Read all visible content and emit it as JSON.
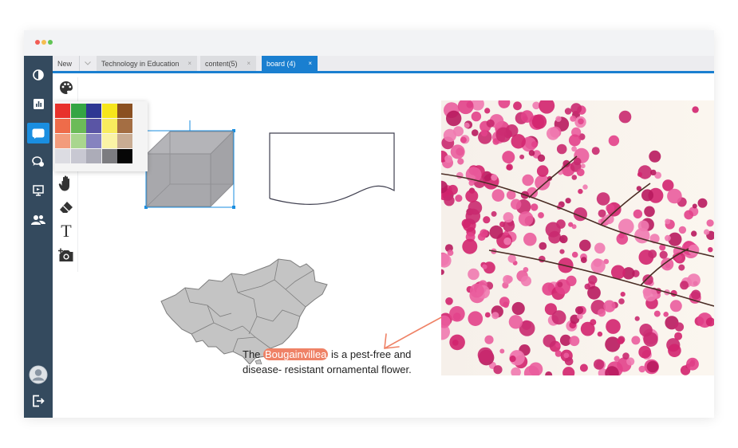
{
  "window_controls": {
    "colors": [
      "#f25c54",
      "#f5bd4f",
      "#61c454"
    ]
  },
  "sidebar": {
    "items": [
      {
        "name": "contrast-icon",
        "active": false
      },
      {
        "name": "bar-chart-icon",
        "active": false
      },
      {
        "name": "whiteboard-icon",
        "active": true
      },
      {
        "name": "chat-icon",
        "active": false
      },
      {
        "name": "presentation-icon",
        "active": false
      },
      {
        "name": "users-icon",
        "active": false
      }
    ],
    "bottom": [
      {
        "name": "avatar-icon"
      },
      {
        "name": "logout-icon"
      }
    ]
  },
  "tabs": [
    {
      "label": "New",
      "active": false
    },
    {
      "label": "Technology in Education",
      "close": "×",
      "active": false
    },
    {
      "label": "content(5)",
      "close": "×",
      "active": false
    },
    {
      "label": "board (4)",
      "close": "×",
      "active": true
    }
  ],
  "toolbar": {
    "tools": [
      "palette-icon",
      "hand-icon",
      "eraser-icon",
      "text-icon",
      "add-image-icon"
    ],
    "text_tool_glyph": "T"
  },
  "palette": {
    "columns": [
      [
        "#e8312b",
        "#ee6c4a",
        "#f39c7c",
        "#dcdce2"
      ],
      [
        "#34a543",
        "#6cbb58",
        "#a9d68e",
        "#c8c8d2"
      ],
      [
        "#2e3793",
        "#5a55a5",
        "#8683bf",
        "#acacb8"
      ],
      [
        "#f6e51b",
        "#f8ec5e",
        "#faf3a6",
        "#7c7c80"
      ],
      [
        "#8a5021",
        "#a46e43",
        "#c9ac93",
        "#060606"
      ]
    ]
  },
  "annotation": {
    "before": "The ",
    "highlight": "Bougainvillea",
    "after": " is a pest-free and disease- resistant ornamental flower.",
    "highlight_color": "#ef8266",
    "arrow_color": "#ef8266"
  },
  "accent_color": "#1a7fd0"
}
